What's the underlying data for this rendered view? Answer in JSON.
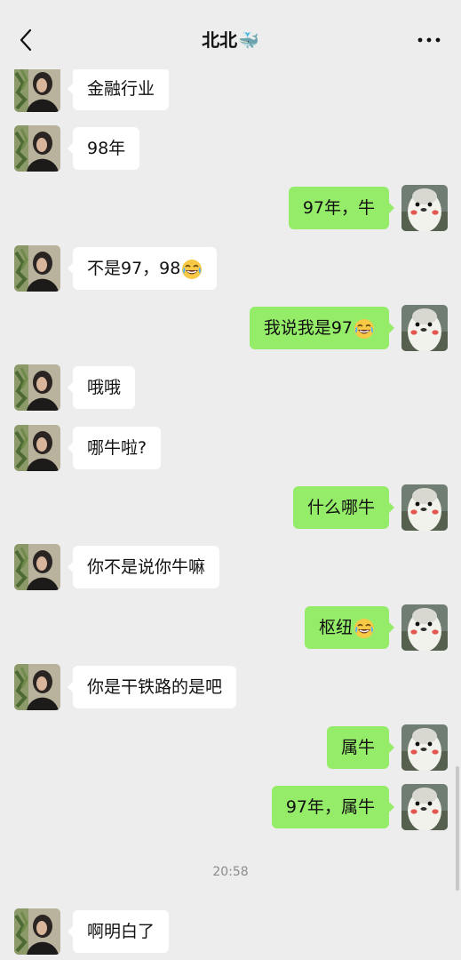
{
  "header": {
    "title": "北北",
    "title_emoji": "whale-icon"
  },
  "timestamp": "20:58",
  "messages": [
    {
      "side": "in",
      "text": "金融行业"
    },
    {
      "side": "in",
      "text": "98年"
    },
    {
      "side": "out",
      "text": "97年，牛"
    },
    {
      "side": "in",
      "text": "不是97，98",
      "emoji": "laughing-tears-emoji"
    },
    {
      "side": "out",
      "text": "我说我是97",
      "emoji": "laughing-tears-emoji"
    },
    {
      "side": "in",
      "text": "哦哦"
    },
    {
      "side": "in",
      "text": "哪牛啦?"
    },
    {
      "side": "out",
      "text": "什么哪牛"
    },
    {
      "side": "in",
      "text": "你不是说你牛嘛"
    },
    {
      "side": "out",
      "text": "枢纽",
      "emoji": "laughing-tears-emoji"
    },
    {
      "side": "in",
      "text": "你是干铁路的是吧"
    },
    {
      "side": "out",
      "text": "属牛"
    },
    {
      "side": "out",
      "text": "97年，属牛"
    },
    {
      "side": "in",
      "text": "啊明白了"
    }
  ],
  "colors": {
    "background": "#ededed",
    "incoming_bubble": "#ffffff",
    "outgoing_bubble": "#95ec69",
    "timestamp_text": "#8c8c8c"
  }
}
